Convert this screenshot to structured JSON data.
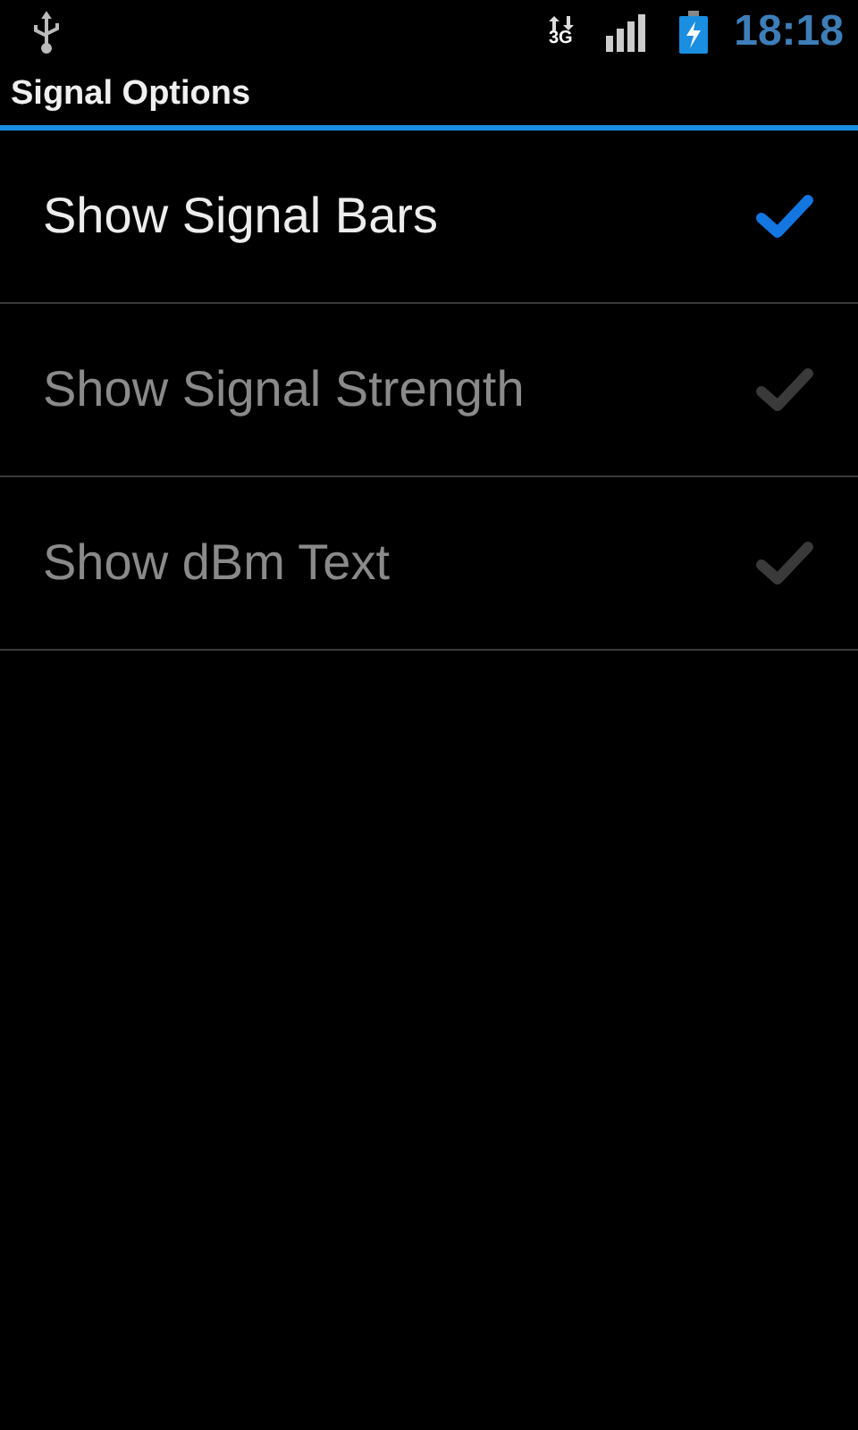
{
  "status_bar": {
    "network": "3G",
    "time": "18:18"
  },
  "title": "Signal Options",
  "options": [
    {
      "label": "Show Signal Bars",
      "checked": true,
      "disabled": false
    },
    {
      "label": "Show Signal Strength",
      "checked": false,
      "disabled": true
    },
    {
      "label": "Show dBm Text",
      "checked": false,
      "disabled": true
    }
  ]
}
